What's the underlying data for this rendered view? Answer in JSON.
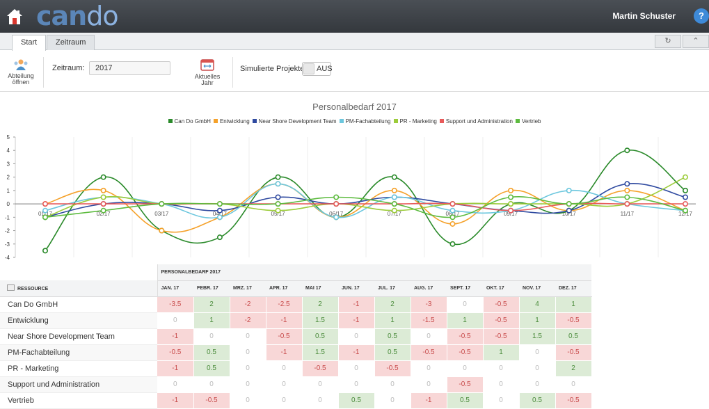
{
  "app": {
    "logo": "cando",
    "logo_a": "can",
    "logo_b": "do",
    "user": "Martin Schuster",
    "help": "?"
  },
  "tabs": [
    {
      "label": "Start"
    },
    {
      "label": "Zeitraum"
    }
  ],
  "toolbar": {
    "abteilung_label": "Abteilung öffnen",
    "zeitraum_label": "Zeitraum:",
    "zeitraum_value": "2017",
    "aktuelles_jahr_label": "Aktuelles Jahr",
    "simuliert_label": "Simulierte Projekte:",
    "simuliert_value": "AUS"
  },
  "chart_data": {
    "type": "line",
    "title": "Personalbedarf 2017",
    "categories": [
      "01/17",
      "02/17",
      "03/17",
      "04/17",
      "05/17",
      "06/17",
      "07/17",
      "08/17",
      "09/17",
      "10/17",
      "11/17",
      "12/17"
    ],
    "ylim": [
      -4,
      5
    ],
    "yticks": [
      5,
      4,
      3,
      2,
      1,
      0,
      -1,
      -2,
      -3,
      -4
    ],
    "legend_position": "top",
    "series": [
      {
        "name": "Can Do GmbH",
        "color": "#2a8a2a",
        "values": [
          -3.5,
          2,
          -2,
          -2.5,
          2,
          -1,
          2,
          -3,
          0,
          -0.5,
          4,
          1
        ]
      },
      {
        "name": "Entwicklung",
        "color": "#f5a12a",
        "values": [
          0,
          1,
          -2,
          -1,
          1.5,
          -1,
          1,
          -1.5,
          1,
          -0.5,
          1,
          -0.5
        ]
      },
      {
        "name": "Near Shore Development Team",
        "color": "#2f4aa0",
        "values": [
          -1,
          0,
          0,
          -0.5,
          0.5,
          0,
          0.5,
          0,
          -0.5,
          -0.5,
          1.5,
          0.5
        ]
      },
      {
        "name": "PM-Fachabteilung",
        "color": "#6cc7de",
        "values": [
          -0.5,
          0.5,
          0,
          -1,
          1.5,
          -1,
          0.5,
          -0.5,
          -0.5,
          1,
          0,
          -0.5
        ]
      },
      {
        "name": "PR - Marketing",
        "color": "#9ccc3a",
        "values": [
          -1,
          0.5,
          0,
          0,
          -0.5,
          0,
          -0.5,
          0,
          0,
          0,
          0,
          2
        ]
      },
      {
        "name": "Support und Administration",
        "color": "#e85a5a",
        "values": [
          0,
          0,
          0,
          0,
          0,
          0,
          0,
          0,
          -0.5,
          0,
          0,
          0
        ]
      },
      {
        "name": "Vertrieb",
        "color": "#5dbb3f",
        "values": [
          -1,
          -0.5,
          0,
          0,
          0,
          0.5,
          0,
          -1,
          0.5,
          0,
          0.5,
          -0.5
        ]
      }
    ]
  },
  "table": {
    "resource_header": "RESSOURCE",
    "group_header": "PERSONALBEDARF 2017",
    "months": [
      "JAN. 17",
      "FEBR. 17",
      "MRZ. 17",
      "APR. 17",
      "MAI 17",
      "JUN. 17",
      "JUL. 17",
      "AUG. 17",
      "SEPT. 17",
      "OKT. 17",
      "NOV. 17",
      "DEZ. 17"
    ],
    "rows": [
      {
        "name": "Can Do GmbH",
        "values": [
          "-3.5",
          "2",
          "-2",
          "-2.5",
          "2",
          "-1",
          "2",
          "-3",
          "0",
          "-0.5",
          "4",
          "1"
        ]
      },
      {
        "name": "Entwicklung",
        "values": [
          "0",
          "1",
          "-2",
          "-1",
          "1.5",
          "-1",
          "1",
          "-1.5",
          "1",
          "-0.5",
          "1",
          "-0.5"
        ]
      },
      {
        "name": "Near Shore Development Team",
        "values": [
          "-1",
          "0",
          "0",
          "-0.5",
          "0.5",
          "0",
          "0.5",
          "0",
          "-0.5",
          "-0.5",
          "1.5",
          "0.5"
        ]
      },
      {
        "name": "PM-Fachabteilung",
        "values": [
          "-0.5",
          "0.5",
          "0",
          "-1",
          "1.5",
          "-1",
          "0.5",
          "-0.5",
          "-0.5",
          "1",
          "0",
          "-0.5"
        ]
      },
      {
        "name": "PR - Marketing",
        "values": [
          "-1",
          "0.5",
          "0",
          "0",
          "-0.5",
          "0",
          "-0.5",
          "0",
          "0",
          "0",
          "0",
          "2"
        ]
      },
      {
        "name": "Support und Administration",
        "values": [
          "0",
          "0",
          "0",
          "0",
          "0",
          "0",
          "0",
          "0",
          "-0.5",
          "0",
          "0",
          "0"
        ]
      },
      {
        "name": "Vertrieb",
        "values": [
          "-1",
          "-0.5",
          "0",
          "0",
          "0",
          "0.5",
          "0",
          "-1",
          "0.5",
          "0",
          "0.5",
          "-0.5"
        ]
      }
    ]
  }
}
